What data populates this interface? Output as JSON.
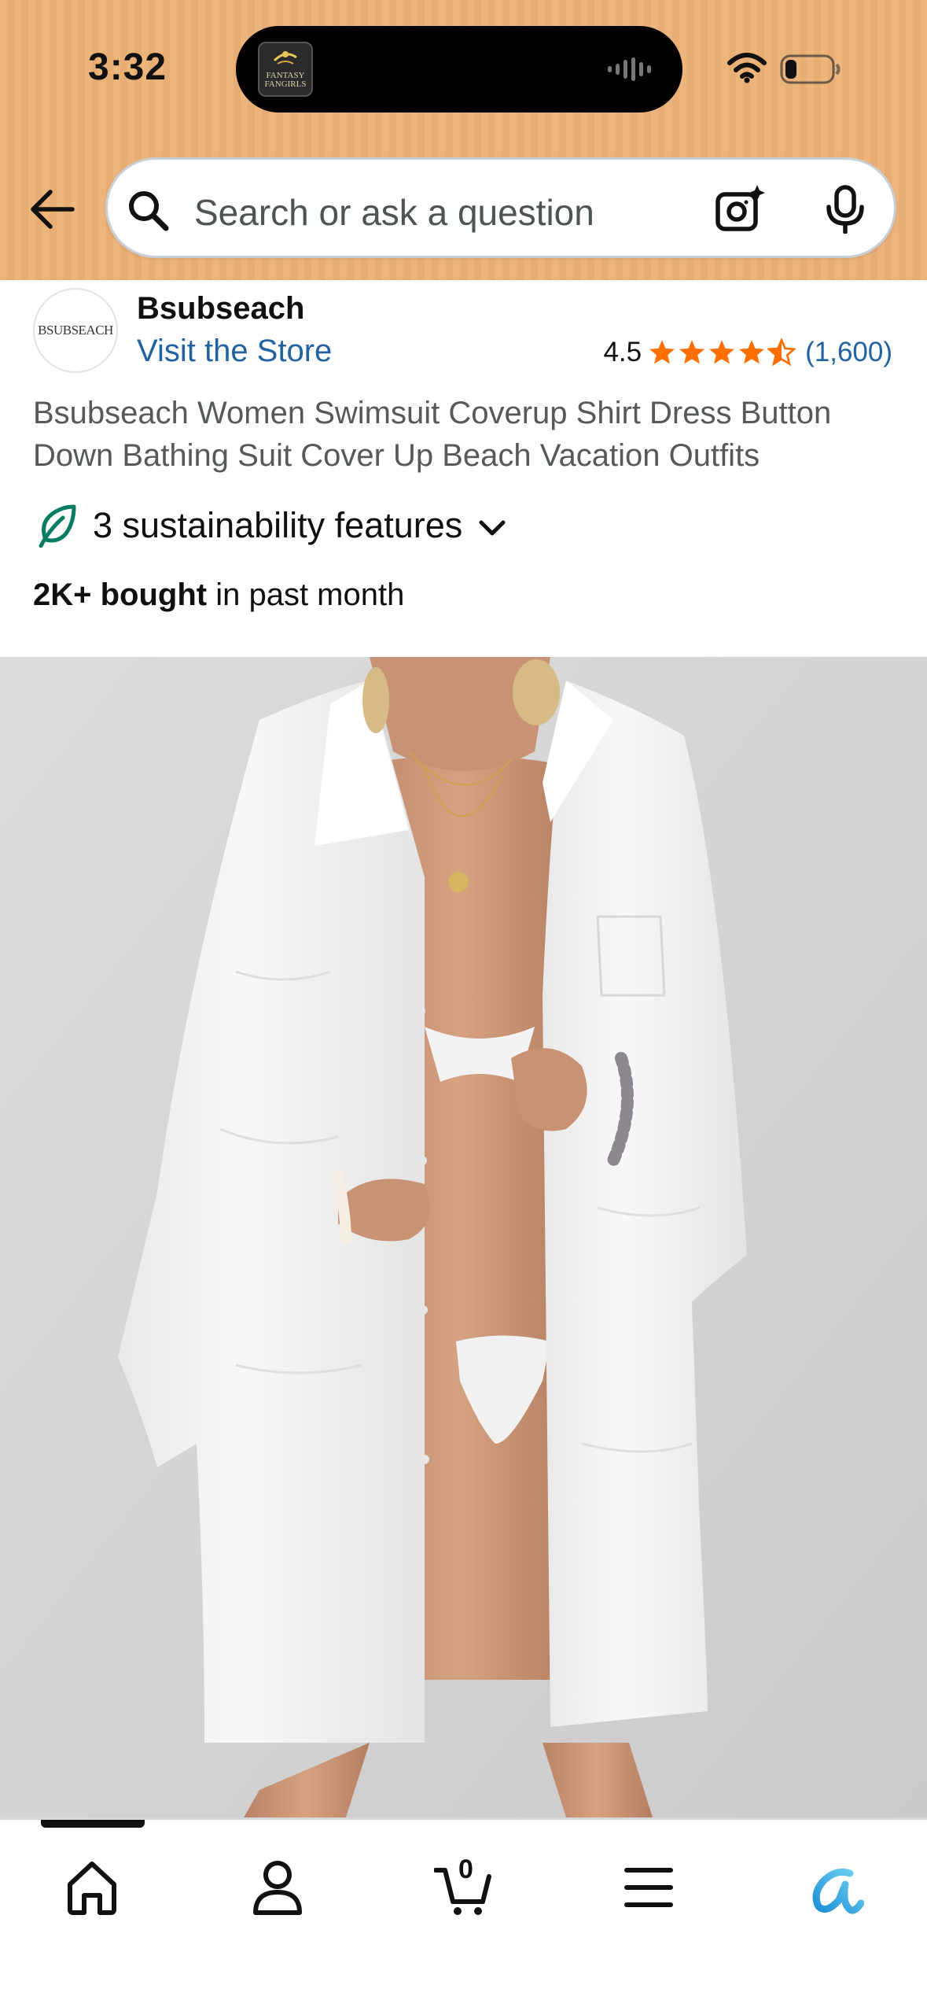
{
  "status_bar": {
    "time": "3:32",
    "now_playing_art_text": "FANTASY FANGIRLS",
    "wifi": "wifi-icon",
    "battery_level": 0.25
  },
  "header": {
    "back_icon": "arrow-left-icon",
    "search": {
      "placeholder": "Search or ask a question",
      "icons": [
        "search-icon",
        "camera-icon",
        "mic-icon"
      ]
    }
  },
  "store": {
    "logo_text": "BSUBSEACH",
    "name": "Bsubseach",
    "link_label": "Visit the Store"
  },
  "rating": {
    "value": "4.5",
    "stars": 4.5,
    "count": "(1,600)",
    "star_color": "#ff6f00"
  },
  "product": {
    "title": "Bsubseach Women Swimsuit Coverup Shirt Dress Button Down Bathing Suit Cover Up Beach Vacation Outfits",
    "sustainability_label": "3 sustainability features",
    "bought_bold": "2K+ bought",
    "bought_rest": " in past month",
    "image_alt": "Model wearing white button-down shirt swimsuit cover-up"
  },
  "bottom_nav": {
    "items": [
      {
        "name": "home",
        "icon": "home-icon"
      },
      {
        "name": "account",
        "icon": "user-icon"
      },
      {
        "name": "cart",
        "icon": "cart-icon",
        "count": "0"
      },
      {
        "name": "menu",
        "icon": "menu-icon"
      },
      {
        "name": "rufus",
        "icon": "rufus-ai-icon"
      }
    ]
  },
  "colors": {
    "header_bg": "#ecb57c",
    "link": "#2162a1",
    "leaf": "#067d62",
    "rufus_gradient": [
      "#1f8fd6",
      "#6fd3f2"
    ]
  }
}
